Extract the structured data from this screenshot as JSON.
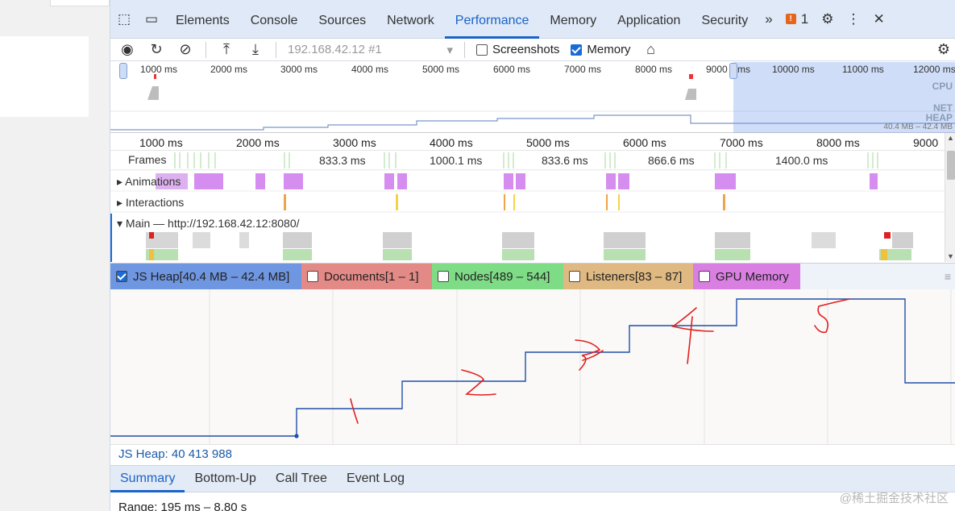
{
  "tabs": {
    "items": [
      "Elements",
      "Console",
      "Sources",
      "Network",
      "Performance",
      "Memory",
      "Application",
      "Security"
    ],
    "more": "»",
    "issues_count": "1"
  },
  "toolbar": {
    "target": "192.168.42.12 #1",
    "screenshots_label": "Screenshots",
    "memory_label": "Memory"
  },
  "overview": {
    "ticks": [
      "1000 ms",
      "2000 ms",
      "3000 ms",
      "4000 ms",
      "5000 ms",
      "6000 ms",
      "7000 ms",
      "8000 ms",
      "9000",
      "ms",
      "10000 ms",
      "11000 ms",
      "12000 ms"
    ],
    "cpu_label": "CPU",
    "net_label": "NET",
    "heap_label": "HEAP",
    "heap_range": "40.4 MB – 42.4 MB"
  },
  "ruler": {
    "ticks": [
      "1000 ms",
      "2000 ms",
      "3000 ms",
      "4000 ms",
      "5000 ms",
      "6000 ms",
      "7000 ms",
      "8000 ms",
      "9000"
    ]
  },
  "tracks": {
    "frames_label": "Frames",
    "frame_times": [
      "833.3 ms",
      "1000.1 ms",
      "833.6 ms",
      "866.6 ms",
      "1400.0 ms"
    ],
    "animations_label": "Animations",
    "interactions_label": "Interactions",
    "main_label": "Main — http://192.168.42.12:8080/"
  },
  "legend": {
    "js_heap": "JS Heap[40.4 MB – 42.4 MB]",
    "documents": "Documents[1 – 1]",
    "nodes": "Nodes[489 – 544]",
    "listeners": "Listeners[83 – 87]",
    "gpu": "GPU Memory",
    "colors": {
      "js_heap": "#6f96e0",
      "documents": "#e38a86",
      "nodes": "#7fdc86",
      "listeners": "#dfb981",
      "gpu": "#da7fe2",
      "line": "#1f4fa8",
      "annotation": "#e02020"
    }
  },
  "heap_readout": "JS Heap: 40 413 988",
  "subtabs": [
    "Summary",
    "Bottom-Up",
    "Call Tree",
    "Event Log"
  ],
  "summary_text": "Range: 195 ms – 8.80 s",
  "watermark": "@稀土掘金技术社区",
  "annotations": [
    "1",
    "2",
    "3",
    "4",
    "5"
  ]
}
